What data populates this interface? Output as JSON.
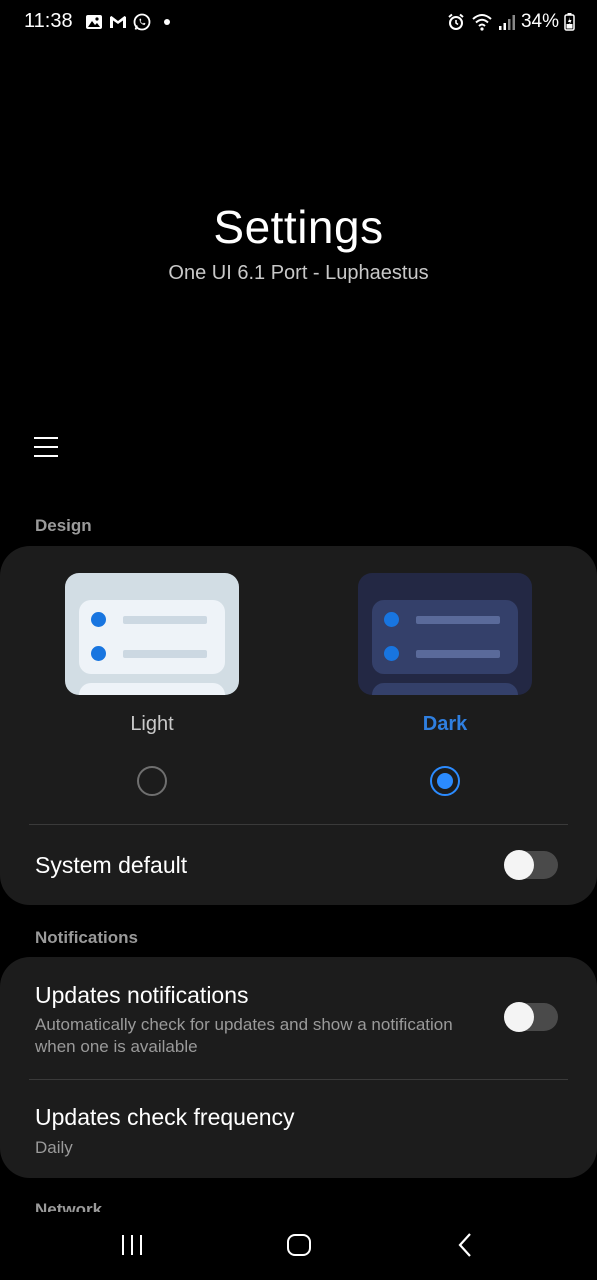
{
  "status_bar": {
    "time": "11:38",
    "battery": "34%",
    "left_icons": [
      "gallery-icon",
      "gmail-icon",
      "whatsapp-icon"
    ],
    "right_icons": [
      "alarm-icon",
      "wifi-icon",
      "signal-icon",
      "battery-icon"
    ]
  },
  "header": {
    "title": "Settings",
    "subtitle": "One UI 6.1 Port - Luphaestus"
  },
  "design": {
    "section_label": "Design",
    "light_label": "Light",
    "dark_label": "Dark",
    "selected": "Dark",
    "system_default_label": "System default",
    "system_default_on": false
  },
  "notifications": {
    "section_label": "Notifications",
    "updates_title": "Updates notifications",
    "updates_desc": "Automatically check for updates and show a notification when one is available",
    "updates_on": false,
    "frequency_title": "Updates check frequency",
    "frequency_value": "Daily"
  },
  "network": {
    "section_label": "Network"
  },
  "colors": {
    "background": "#000000",
    "card": "#1c1c1c",
    "accent": "#2b8bff",
    "section_label": "#9a9a9a"
  }
}
